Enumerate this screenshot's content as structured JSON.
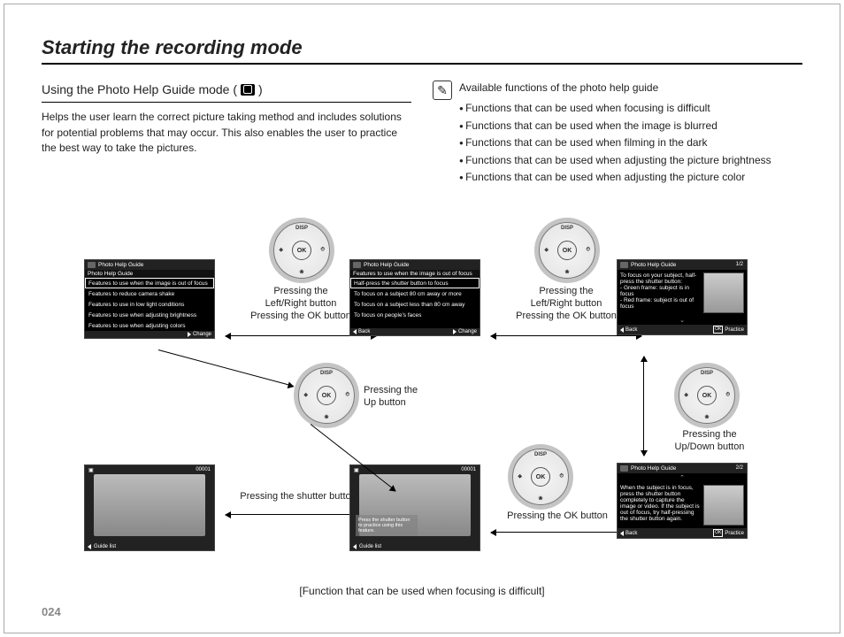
{
  "page_number": "024",
  "title": "Starting the recording mode",
  "subhead_prefix": "Using the Photo Help Guide mode (",
  "subhead_suffix": " )",
  "intro": "Helps the user learn the correct picture taking method and includes solutions for potential problems that may occur. This also enables the user to practice the best way to take the pictures.",
  "note_heading": "Available functions of the photo help guide",
  "bullets": [
    "Functions that can be used when focusing is difficult",
    "Functions that can be used when the image is blurred",
    "Functions that can be used when filming in the dark",
    "Functions that can be used when adjusting the picture brightness",
    "Functions that can be used when adjusting the picture color"
  ],
  "lcd1": {
    "header": "Photo Help Guide",
    "sub": "Photo Help Guide",
    "rows": [
      "Features to use when the image is out of focus",
      "Features to reduce camera shake",
      "Features to use in low light conditions",
      "Features to use when adjusting brightness",
      "Features to use when adjusting colors"
    ],
    "ftr_change": "Change"
  },
  "lcd2": {
    "header": "Photo Help Guide",
    "sub": "Features to use when the image is out of focus",
    "rows": [
      "Half-press the shutter button to focus",
      "To focus on a subject 80 cm away or more",
      "To focus on a subject less than 80 cm away",
      "To focus on people's faces"
    ],
    "ftr_back": "Back",
    "ftr_change": "Change"
  },
  "lcd3": {
    "header": "Photo Help Guide",
    "page": "1/2",
    "body": "To focus on your subject, half-press the shutter button:\n- Green frame: subject is in focus\n- Red frame: subject is out of focus",
    "ftr_back": "Back",
    "ftr_practice": "Practice"
  },
  "lcd4": {
    "header": "Photo Help Guide",
    "page": "2/2",
    "body": "When the subject is in focus, press the shutter button completely to capture the image or video. If the subject is out of focus, try half-pressing the shutter button again.",
    "ftr_back": "Back",
    "ftr_practice": "Practice"
  },
  "photo_mid": {
    "overlay": "Press the shutter button to practice using this feature.",
    "ftr": "Guide list",
    "top_count": "00001"
  },
  "photo_left": {
    "ftr": "Guide list",
    "top_count": "00001"
  },
  "labels": {
    "lr_ok": "Pressing the\nLeft/Right button\nPressing the OK button",
    "up": "Pressing the\nUp button",
    "updown": "Pressing the\nUp/Down button",
    "shutter": "Pressing the shutter button",
    "ok": "Pressing the OK button"
  },
  "caption": "[Function that can be used when focusing is difficult]",
  "pad": {
    "ok": "OK",
    "top": "DISP",
    "bottom": "❀",
    "left": "❖",
    "right": "⏱"
  }
}
